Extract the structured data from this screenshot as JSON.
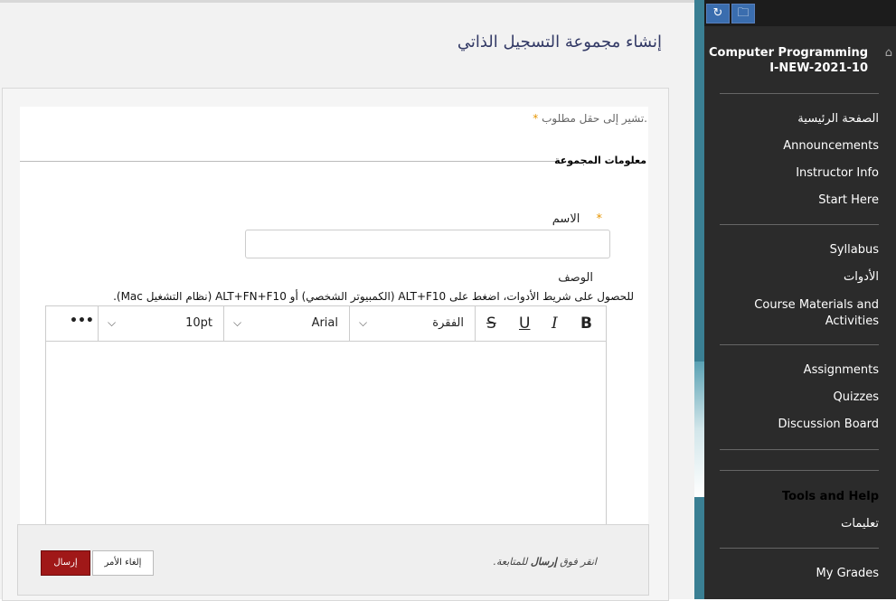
{
  "page": {
    "title": "إنشاء مجموعة التسجيل الذاتي",
    "required_note": "تشير إلى حقل مطلوب.",
    "required_star": "*"
  },
  "form": {
    "section_legend": "معلومات المجموعة",
    "name_label": "الاسم",
    "name_value": "",
    "description_label": "الوصف",
    "toolbar_hint": "للحصول على شريط الأدوات، اضغط على ALT+F10 (الكمبيوتر الشخصي) أو ALT+FN+F10 (نظام التشغيل Mac).",
    "editor": {
      "bold_icon": "bold-icon",
      "bold_label": "B",
      "italic_label": "I",
      "underline_label": "U",
      "strike_label": "S",
      "paragraph_value": "الفقرة",
      "font_value": "Arial",
      "size_value": "10pt",
      "more_label": "•••",
      "chevron": "⌵"
    }
  },
  "footer": {
    "hint_prefix": "انقر فوق ",
    "hint_bold": "إرسال",
    "hint_suffix": " للمتابعة.",
    "submit_label": "إرسال",
    "cancel_label": "إلغاء الأمر"
  },
  "sidebar": {
    "top_buttons": [
      {
        "icon": "refresh-icon",
        "glyph": "↻"
      },
      {
        "icon": "folder-icon",
        "glyph": "🗀"
      }
    ],
    "course_title": "Computer Programming I-NEW-2021-10",
    "home_icon": "⌂",
    "items": [
      {
        "label": "الصفحة الرئيسية"
      },
      {
        "label": "Announcements"
      },
      {
        "label": "Instructor Info"
      },
      {
        "label": "Start Here"
      },
      {
        "label": "Syllabus"
      },
      {
        "label": "الأدوات"
      },
      {
        "label": "Course Materials and Activities"
      },
      {
        "label": "Assignments"
      },
      {
        "label": "Quizzes"
      },
      {
        "label": "Discussion Board"
      },
      {
        "label": "تعليمات"
      },
      {
        "label": "My Grades"
      }
    ],
    "tools_heading": "Tools and Help"
  },
  "colors": {
    "accent_submit": "#a01818",
    "sidebar_bg": "#2b2b2b",
    "title_color": "#333a66",
    "required_star": "#e69500"
  }
}
